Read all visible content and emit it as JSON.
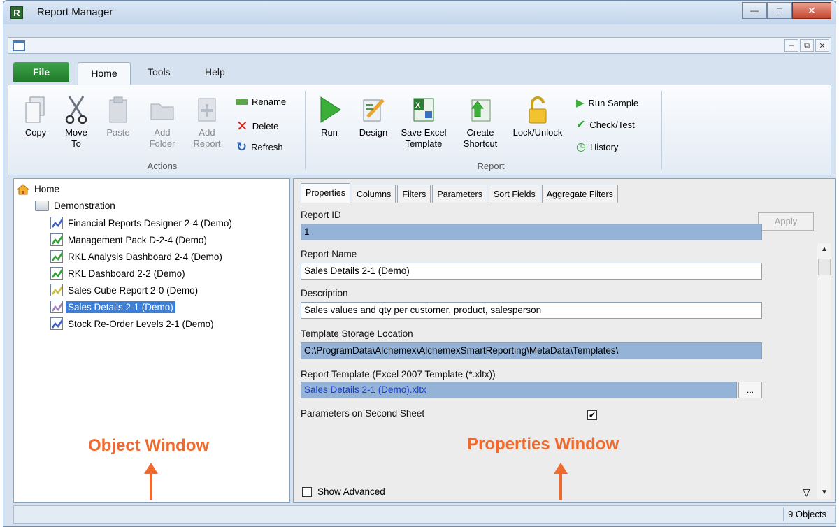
{
  "window": {
    "title": "Report Manager",
    "app_icon": "R"
  },
  "ribbon": {
    "tabs": {
      "file": "File",
      "home": "Home",
      "tools": "Tools",
      "help": "Help"
    },
    "actions": {
      "copy": "Copy",
      "move_to_1": "Move",
      "move_to_2": "To",
      "paste": "Paste",
      "add_folder_1": "Add",
      "add_folder_2": "Folder",
      "add_report_1": "Add",
      "add_report_2": "Report",
      "rename": "Rename",
      "delete": "Delete",
      "refresh": "Refresh",
      "group_label": "Actions"
    },
    "report": {
      "run": "Run",
      "design": "Design",
      "save_excel_1": "Save Excel",
      "save_excel_2": "Template",
      "create_shortcut_1": "Create",
      "create_shortcut_2": "Shortcut",
      "lock_unlock": "Lock/Unlock",
      "run_sample": "Run Sample",
      "check_test": "Check/Test",
      "history": "History",
      "group_label": "Report"
    }
  },
  "tree": {
    "home": "Home",
    "folder": "Demonstration",
    "items": [
      {
        "label": "Financial Reports Designer 2-4 (Demo)",
        "color": "#3a5fcd"
      },
      {
        "label": "Management Pack D-2-4 (Demo)",
        "color": "#2fa535"
      },
      {
        "label": "RKL Analysis Dashboard 2-4 (Demo)",
        "color": "#2fa535"
      },
      {
        "label": "RKL Dashboard 2-2 (Demo)",
        "color": "#2fa535"
      },
      {
        "label": "Sales Cube Report 2-0 (Demo)",
        "color": "#c9c23a"
      },
      {
        "label": "Sales Details 2-1 (Demo)",
        "color": "#a080c0"
      },
      {
        "label": "Stock Re-Order Levels 2-1 (Demo)",
        "color": "#3a5fcd"
      }
    ],
    "selected_index": 5
  },
  "properties": {
    "tabs": [
      "Properties",
      "Columns",
      "Filters",
      "Parameters",
      "Sort Fields",
      "Aggregate Filters"
    ],
    "apply": "Apply",
    "report_id_label": "Report ID",
    "report_id": "1",
    "report_name_label": "Report Name",
    "report_name": "Sales Details 2-1 (Demo)",
    "description_label": "Description",
    "description": "Sales values and qty per customer, product, salesperson",
    "template_location_label": "Template Storage Location",
    "template_location": "C:\\ProgramData\\Alchemex\\AlchemexSmartReporting\\MetaData\\Templates\\",
    "report_template_label": "Report Template (Excel 2007 Template (*.xltx))",
    "report_template": "Sales Details 2-1 (Demo).xltx",
    "ellipsis": "...",
    "params_second_sheet_label": "Parameters on Second Sheet",
    "params_second_sheet_checked": true,
    "show_advanced_label": "Show Advanced",
    "show_advanced_checked": false
  },
  "annotations": {
    "object_window": "Object Window",
    "properties_window": "Properties Window"
  },
  "status": {
    "count": "9 Objects"
  }
}
